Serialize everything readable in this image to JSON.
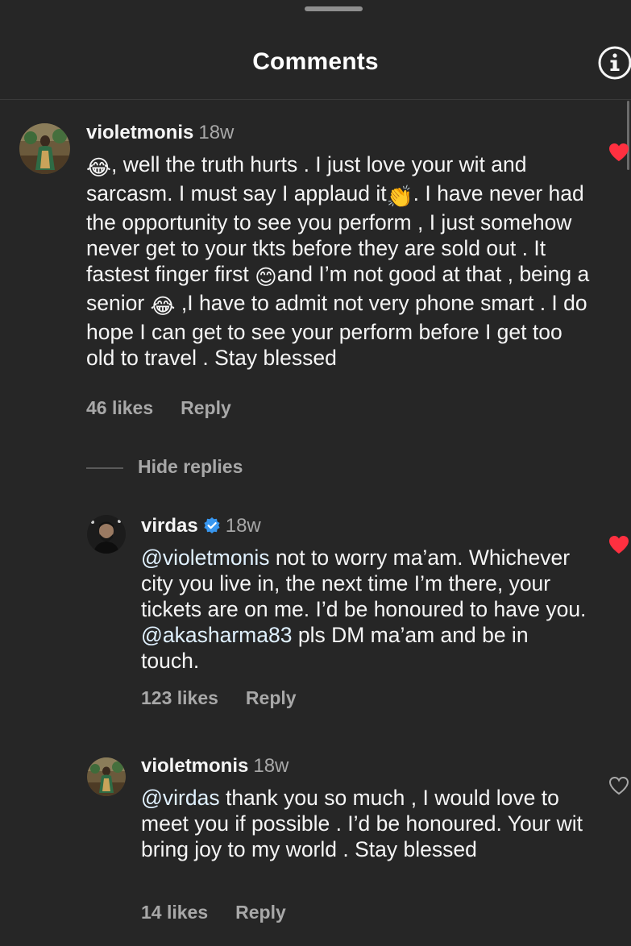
{
  "header": {
    "title": "Comments"
  },
  "colors": {
    "background": "#262626",
    "text_primary": "#f5f5f5",
    "text_secondary": "#a8a8a8",
    "mention": "#e0f1ff",
    "like_active": "#ff3040",
    "verified": "#3897f0"
  },
  "comments": [
    {
      "username": "violetmonis",
      "time": "18w",
      "emoji_lead": "😂",
      "text_1": ", well the truth hurts .  I just love your wit and sarcasm.  I must say I applaud it",
      "emoji_clap": "👏",
      "text_2": ". I have never had the opportunity to see you perform , I just somehow never get to your tkts before they are sold out . It fastest finger first ",
      "emoji_smile": "😊",
      "text_3": "and I’m not good at that , being a senior ",
      "emoji_laugh": "😂",
      "text_4": " ,I have to admit not very phone smart . I do hope I can get to see your perform before I get too old to travel . Stay blessed",
      "likes": "46 likes",
      "reply_label": "Reply",
      "liked": true,
      "like_icon": "heart-filled-icon"
    }
  ],
  "replies_toggle": {
    "label": "Hide replies"
  },
  "replies": [
    {
      "username": "virdas",
      "verified": true,
      "time": "18w",
      "mention_1": "@violetmonis",
      "text_1": " not to worry ma’am. Whichever city you live in, the next time I’m there, your tickets are on me. I’d be honoured to have you. ",
      "mention_2": "@akasharma83",
      "text_2": " pls DM ma’am and be in touch.",
      "likes": "123 likes",
      "reply_label": "Reply",
      "liked": true,
      "like_icon": "heart-filled-icon"
    },
    {
      "username": "violetmonis",
      "verified": false,
      "time": "18w",
      "mention_1": "@virdas",
      "text_1": "  thank you so much , I would love to meet you if possible . I’d be honoured. Your wit bring joy to my world . Stay blessed",
      "likes": "14 likes",
      "reply_label": "Reply",
      "liked": false,
      "like_icon": "heart-outline-icon"
    }
  ]
}
